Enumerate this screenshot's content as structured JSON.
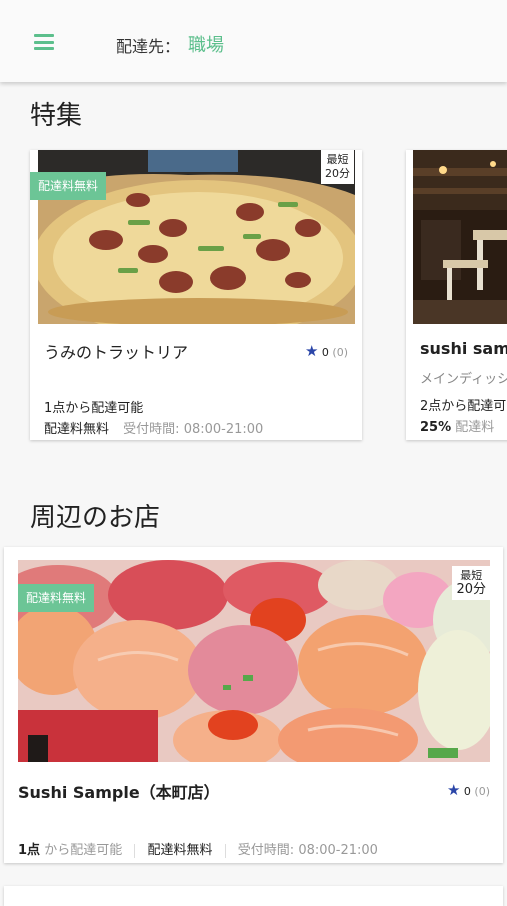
{
  "header": {
    "deliver_label": "配達先：",
    "deliver_value": "職場"
  },
  "featured": {
    "title": "特集",
    "cards": [
      {
        "free_badge": "配達料無料",
        "time_badge_line1": "最短",
        "time_badge_line2": "20分",
        "name": "うみのトラットリア",
        "rating": "0",
        "rating_count": "(0)",
        "min_order": "1点から配達可能",
        "fee": "配達料無料",
        "hours_label": "受付時間:",
        "hours": "08:00-21:00"
      },
      {
        "name": "sushi samp",
        "category": "メインディッシ",
        "min_order": "2点から配達可",
        "discount": "25%",
        "fee_label": "配達料"
      }
    ]
  },
  "nearby": {
    "title": "周辺のお店",
    "cards": [
      {
        "free_badge": "配達料無料",
        "time_badge_line1": "最短",
        "time_badge_line2": "20分",
        "name": "Sushi Sample（本町店）",
        "rating": "0",
        "rating_count": "(0)",
        "min_order_num": "1点",
        "min_order_rest": "から配達可能",
        "fee": "配達料無料",
        "hours_label": "受付時間:",
        "hours": "08:00-21:00"
      }
    ]
  },
  "colors": {
    "accent": "#5cbf8c",
    "badge": "#6cc596",
    "star": "#2b46a8"
  }
}
